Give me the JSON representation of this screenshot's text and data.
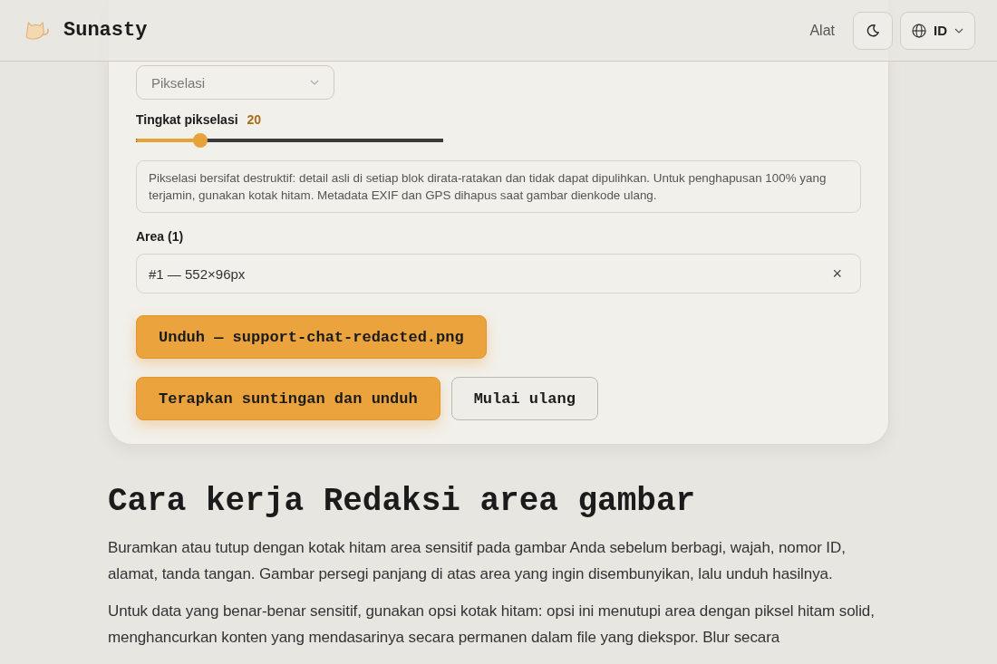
{
  "header": {
    "brand": "Sunasty",
    "nav_link": "Alat",
    "language": "ID"
  },
  "editor": {
    "mode_select": {
      "value": "Pikselasi"
    },
    "slider": {
      "label": "Tingkat pikselasi",
      "reading": "20",
      "level": 0.21
    },
    "notice": "Pikselasi bersifat destruktif: detail asli di setiap blok dirata-ratakan dan tidak dapat dipulihkan. Untuk penghapusan 100% yang terjamin, gunakan kotak hitam. Metadata EXIF dan GPS dihapus saat gambar dienkode ulang.",
    "areas_label": "Area (1)",
    "areas": [
      {
        "label": "#1 — 552×96px",
        "remove": "×"
      }
    ],
    "download_button": "Unduh — support-chat-redacted.png",
    "buttons": [
      {
        "label": "Terapkan suntingan dan unduh",
        "kind": "primary"
      },
      {
        "label": "Mulai ulang",
        "kind": "secondary"
      }
    ]
  },
  "article": {
    "heading": "Cara kerja Redaksi area gambar",
    "paragraphs": [
      "Buramkan atau tutup dengan kotak hitam area sensitif pada gambar Anda sebelum berbagi, wajah, nomor ID, alamat, tanda tangan. Gambar persegi panjang di atas area yang ingin disembunyikan, lalu unduh hasilnya.",
      "Untuk data yang benar-benar sensitif, gunakan opsi kotak hitam: opsi ini menutupi area dengan piksel hitam solid, menghancurkan konten yang mendasarinya secara permanen dalam file yang diekspor. Blur secara"
    ]
  }
}
